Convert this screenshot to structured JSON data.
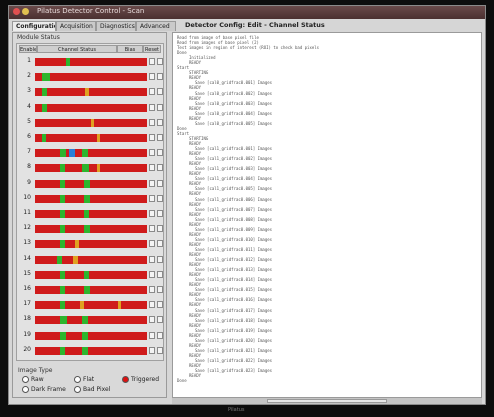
{
  "window": {
    "title": "Pilatus Detector Control - Scan",
    "tabs": [
      "Configuration",
      "Acquisition",
      "Diagnostics",
      "Advanced"
    ],
    "status_title": "Detector Config: Edit - Channel Status"
  },
  "left_panel": {
    "group_title": "Module Status",
    "columns": [
      "Enable",
      "Channel Status",
      "Bias",
      "Reset"
    ],
    "rows": [
      {
        "num": "1",
        "marks": [
          {
            "pos": 0.28,
            "w": 0.03,
            "c": "#2db52d"
          }
        ]
      },
      {
        "num": "2",
        "marks": [
          {
            "pos": 0.06,
            "w": 0.07,
            "c": "#2db52d"
          }
        ]
      },
      {
        "num": "3",
        "marks": [
          {
            "pos": 0.06,
            "w": 0.05,
            "c": "#2db52d"
          },
          {
            "pos": 0.45,
            "w": 0.03,
            "c": "#e0a020"
          }
        ]
      },
      {
        "num": "4",
        "marks": [
          {
            "pos": 0.06,
            "w": 0.05,
            "c": "#2db52d"
          }
        ]
      },
      {
        "num": "5",
        "marks": [
          {
            "pos": 0.5,
            "w": 0.03,
            "c": "#e0a020"
          }
        ]
      },
      {
        "num": "6",
        "marks": [
          {
            "pos": 0.06,
            "w": 0.04,
            "c": "#2db52d"
          },
          {
            "pos": 0.55,
            "w": 0.03,
            "c": "#e0a020"
          }
        ]
      },
      {
        "num": "7",
        "marks": [
          {
            "pos": 0.22,
            "w": 0.06,
            "c": "#2db52d"
          },
          {
            "pos": 0.3,
            "w": 0.06,
            "c": "#2a7fd8"
          },
          {
            "pos": 0.42,
            "w": 0.05,
            "c": "#2db52d"
          }
        ]
      },
      {
        "num": "8",
        "marks": [
          {
            "pos": 0.22,
            "w": 0.05,
            "c": "#2db52d"
          },
          {
            "pos": 0.42,
            "w": 0.06,
            "c": "#2db52d"
          },
          {
            "pos": 0.55,
            "w": 0.03,
            "c": "#e0a020"
          }
        ]
      },
      {
        "num": "9",
        "marks": [
          {
            "pos": 0.22,
            "w": 0.05,
            "c": "#2db52d"
          },
          {
            "pos": 0.44,
            "w": 0.05,
            "c": "#2db52d"
          }
        ]
      },
      {
        "num": "10",
        "marks": [
          {
            "pos": 0.22,
            "w": 0.05,
            "c": "#2db52d"
          },
          {
            "pos": 0.44,
            "w": 0.05,
            "c": "#2db52d"
          }
        ]
      },
      {
        "num": "11",
        "marks": [
          {
            "pos": 0.22,
            "w": 0.05,
            "c": "#2db52d"
          },
          {
            "pos": 0.44,
            "w": 0.04,
            "c": "#2db52d"
          }
        ]
      },
      {
        "num": "12",
        "marks": [
          {
            "pos": 0.22,
            "w": 0.05,
            "c": "#2db52d"
          },
          {
            "pos": 0.44,
            "w": 0.05,
            "c": "#2db52d"
          }
        ]
      },
      {
        "num": "13",
        "marks": [
          {
            "pos": 0.22,
            "w": 0.05,
            "c": "#2db52d"
          },
          {
            "pos": 0.36,
            "w": 0.03,
            "c": "#e0a020"
          }
        ]
      },
      {
        "num": "14",
        "marks": [
          {
            "pos": 0.2,
            "w": 0.04,
            "c": "#2db52d"
          },
          {
            "pos": 0.34,
            "w": 0.04,
            "c": "#e0a020"
          }
        ]
      },
      {
        "num": "15",
        "marks": [
          {
            "pos": 0.22,
            "w": 0.05,
            "c": "#2db52d"
          },
          {
            "pos": 0.44,
            "w": 0.04,
            "c": "#2db52d"
          }
        ]
      },
      {
        "num": "16",
        "marks": [
          {
            "pos": 0.22,
            "w": 0.05,
            "c": "#2db52d"
          },
          {
            "pos": 0.44,
            "w": 0.05,
            "c": "#2db52d"
          }
        ]
      },
      {
        "num": "17",
        "marks": [
          {
            "pos": 0.22,
            "w": 0.05,
            "c": "#2db52d"
          },
          {
            "pos": 0.4,
            "w": 0.04,
            "c": "#e0a020"
          },
          {
            "pos": 0.74,
            "w": 0.03,
            "c": "#e0a020"
          }
        ]
      },
      {
        "num": "18",
        "marks": [
          {
            "pos": 0.22,
            "w": 0.07,
            "c": "#2db52d"
          },
          {
            "pos": 0.42,
            "w": 0.05,
            "c": "#2db52d"
          }
        ]
      },
      {
        "num": "19",
        "marks": [
          {
            "pos": 0.22,
            "w": 0.06,
            "c": "#2db52d"
          },
          {
            "pos": 0.42,
            "w": 0.05,
            "c": "#2db52d"
          }
        ]
      },
      {
        "num": "20",
        "marks": [
          {
            "pos": 0.22,
            "w": 0.05,
            "c": "#2db52d"
          },
          {
            "pos": 0.42,
            "w": 0.05,
            "c": "#2db52d"
          }
        ]
      }
    ],
    "image_type": {
      "label": "Image Type",
      "options": [
        "Raw",
        "Flat",
        "Triggered",
        "Dark Frame",
        "Bad Pixel"
      ],
      "selected": "Triggered"
    }
  },
  "log": {
    "lines": [
      {
        "t": "Read from image of base pixel file",
        "i": 0
      },
      {
        "t": "Read from images of base pixel (2)",
        "i": 0
      },
      {
        "t": "Test images in region of interest (ROI) to check bad pixels",
        "i": 0
      },
      {
        "t": "Done",
        "i": 0
      },
      {
        "t": "Initialized",
        "i": 1
      },
      {
        "t": "READY",
        "i": 1
      },
      {
        "t": "Start",
        "i": 0
      },
      {
        "t": "STARTING",
        "i": 1
      },
      {
        "t": "READY",
        "i": 1
      },
      {
        "t": "Save [cal0_gridfrac0.001] Images",
        "i": 2
      },
      {
        "t": "READY",
        "i": 1
      },
      {
        "t": "Save [cal0_gridfrac0.002] Images",
        "i": 2
      },
      {
        "t": "READY",
        "i": 1
      },
      {
        "t": "Save [cal0_gridfrac0.003] Images",
        "i": 2
      },
      {
        "t": "READY",
        "i": 1
      },
      {
        "t": "Save [cal0_gridfrac0.004] Images",
        "i": 2
      },
      {
        "t": "READY",
        "i": 1
      },
      {
        "t": "Save [cal0_gridfrac0.005] Images",
        "i": 2
      },
      {
        "t": "Done",
        "i": 0
      },
      {
        "t": "Start",
        "i": 0
      },
      {
        "t": "STARTING",
        "i": 1
      },
      {
        "t": "READY",
        "i": 1
      },
      {
        "t": "Save [cal1_gridfrac0.001] Images",
        "i": 2
      },
      {
        "t": "READY",
        "i": 1
      },
      {
        "t": "Save [cal1_gridfrac0.002] Images",
        "i": 2
      },
      {
        "t": "READY",
        "i": 1
      },
      {
        "t": "Save [cal1_gridfrac0.003] Images",
        "i": 2
      },
      {
        "t": "READY",
        "i": 1
      },
      {
        "t": "Save [cal1_gridfrac0.004] Images",
        "i": 2
      },
      {
        "t": "READY",
        "i": 1
      },
      {
        "t": "Save [cal1_gridfrac0.005] Images",
        "i": 2
      },
      {
        "t": "READY",
        "i": 1
      },
      {
        "t": "Save [cal1_gridfrac0.006] Images",
        "i": 2
      },
      {
        "t": "READY",
        "i": 1
      },
      {
        "t": "Save [cal1_gridfrac0.007] Images",
        "i": 2
      },
      {
        "t": "READY",
        "i": 1
      },
      {
        "t": "Save [cal1_gridfrac0.008] Images",
        "i": 2
      },
      {
        "t": "READY",
        "i": 1
      },
      {
        "t": "Save [cal1_gridfrac0.009] Images",
        "i": 2
      },
      {
        "t": "READY",
        "i": 1
      },
      {
        "t": "Save [cal1_gridfrac0.010] Images",
        "i": 2
      },
      {
        "t": "READY",
        "i": 1
      },
      {
        "t": "Save [cal1_gridfrac0.011] Images",
        "i": 2
      },
      {
        "t": "READY",
        "i": 1
      },
      {
        "t": "Save [cal1_gridfrac0.012] Images",
        "i": 2
      },
      {
        "t": "READY",
        "i": 1
      },
      {
        "t": "Save [cal1_gridfrac0.013] Images",
        "i": 2
      },
      {
        "t": "READY",
        "i": 1
      },
      {
        "t": "Save [cal1_gridfrac0.014] Images",
        "i": 2
      },
      {
        "t": "READY",
        "i": 1
      },
      {
        "t": "Save [cal1_gridfrac0.015] Images",
        "i": 2
      },
      {
        "t": "READY",
        "i": 1
      },
      {
        "t": "Save [cal1_gridfrac0.016] Images",
        "i": 2
      },
      {
        "t": "READY",
        "i": 1
      },
      {
        "t": "Save [cal1_gridfrac0.017] Images",
        "i": 2
      },
      {
        "t": "READY",
        "i": 1
      },
      {
        "t": "Save [cal1_gridfrac0.018] Images",
        "i": 2
      },
      {
        "t": "READY",
        "i": 1
      },
      {
        "t": "Save [cal1_gridfrac0.019] Images",
        "i": 2
      },
      {
        "t": "READY",
        "i": 1
      },
      {
        "t": "Save [cal1_gridfrac0.020] Images",
        "i": 2
      },
      {
        "t": "READY",
        "i": 1
      },
      {
        "t": "Save [cal1_gridfrac0.021] Images",
        "i": 2
      },
      {
        "t": "READY",
        "i": 1
      },
      {
        "t": "Save [cal1_gridfrac0.022] Images",
        "i": 2
      },
      {
        "t": "READY",
        "i": 1
      },
      {
        "t": "Save [cal1_gridfrac0.023] Images",
        "i": 2
      },
      {
        "t": "READY",
        "i": 1
      },
      {
        "t": "Done",
        "i": 0
      }
    ]
  },
  "footer": {
    "caption": "Pilatus"
  },
  "colors": {
    "bar": "#cf1b1b",
    "ok": "#2db52d",
    "warn": "#e0a020",
    "info": "#2a7fd8"
  }
}
